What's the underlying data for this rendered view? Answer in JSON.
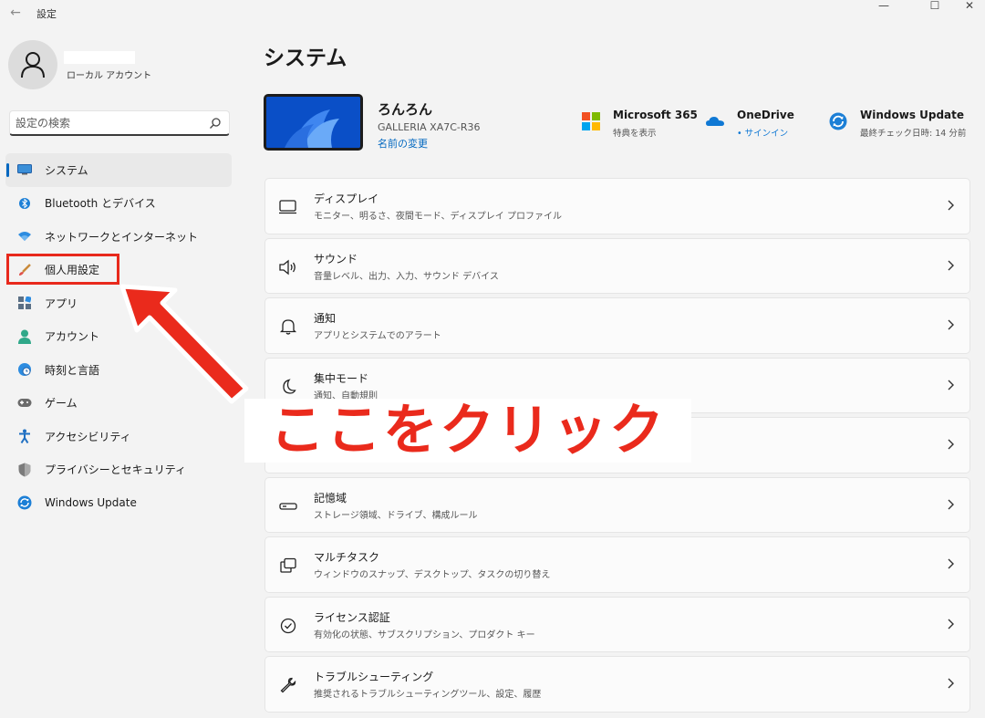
{
  "window": {
    "title": "設定",
    "back_glyph": "←",
    "minimize_glyph": "—",
    "maximize_glyph": "☐",
    "close_glyph": "✕"
  },
  "account": {
    "type": "ローカル アカウント",
    "avatar_icon": "person-icon"
  },
  "search": {
    "placeholder": "設定の検索",
    "icon": "search-icon"
  },
  "sidebar": {
    "items": [
      {
        "label": "システム",
        "icon": "monitor-icon",
        "active": true
      },
      {
        "label": "Bluetooth とデバイス",
        "icon": "bluetooth-icon"
      },
      {
        "label": "ネットワークとインターネット",
        "icon": "wifi-icon"
      },
      {
        "label": "個人用設定",
        "icon": "brush-icon"
      },
      {
        "label": "アプリ",
        "icon": "apps-icon"
      },
      {
        "label": "アカウント",
        "icon": "account-icon"
      },
      {
        "label": "時刻と言語",
        "icon": "globe-clock-icon"
      },
      {
        "label": "ゲーム",
        "icon": "gamepad-icon"
      },
      {
        "label": "アクセシビリティ",
        "icon": "accessibility-icon"
      },
      {
        "label": "プライバシーとセキュリティ",
        "icon": "shield-icon"
      },
      {
        "label": "Windows Update",
        "icon": "update-icon"
      }
    ]
  },
  "main": {
    "title": "システム",
    "device": {
      "name": "ろんろん",
      "model": "GALLERIA XA7C-R36",
      "rename": "名前の変更"
    },
    "quick_links": [
      {
        "title": "Microsoft 365",
        "sub": "特典を表示",
        "icon": "microsoft-logo-icon"
      },
      {
        "title": "OneDrive",
        "sub": "• サインイン",
        "icon": "cloud-icon"
      },
      {
        "title": "Windows Update",
        "sub": "最終チェック日時: 14 分前",
        "icon": "update-icon"
      }
    ],
    "cards": [
      {
        "title": "ディスプレイ",
        "sub": "モニター、明るさ、夜間モード、ディスプレイ プロファイル",
        "icon": "display-icon"
      },
      {
        "title": "サウンド",
        "sub": "音量レベル、出力、入力、サウンド デバイス",
        "icon": "speaker-icon"
      },
      {
        "title": "通知",
        "sub": "アプリとシステムでのアラート",
        "icon": "bell-icon"
      },
      {
        "title": "集中モード",
        "sub": "通知、自動規則",
        "icon": "moon-icon"
      },
      {
        "title": "",
        "sub": "",
        "icon": ""
      },
      {
        "title": "記憶域",
        "sub": "ストレージ領域、ドライブ、構成ルール",
        "icon": "storage-icon"
      },
      {
        "title": "マルチタスク",
        "sub": "ウィンドウのスナップ、デスクトップ、タスクの切り替え",
        "icon": "multitask-icon"
      },
      {
        "title": "ライセンス認証",
        "sub": "有効化の状態、サブスクリプション、プロダクト キー",
        "icon": "check-circle-icon"
      },
      {
        "title": "トラブルシューティング",
        "sub": "推奨されるトラブルシューティングツール、設定、履歴",
        "icon": "wrench-icon"
      }
    ]
  },
  "annotation": {
    "callout": "ここをクリック",
    "color": "#ea2a1c"
  },
  "colors": {
    "accent": "#0067c0",
    "background": "#f3f3f3"
  }
}
